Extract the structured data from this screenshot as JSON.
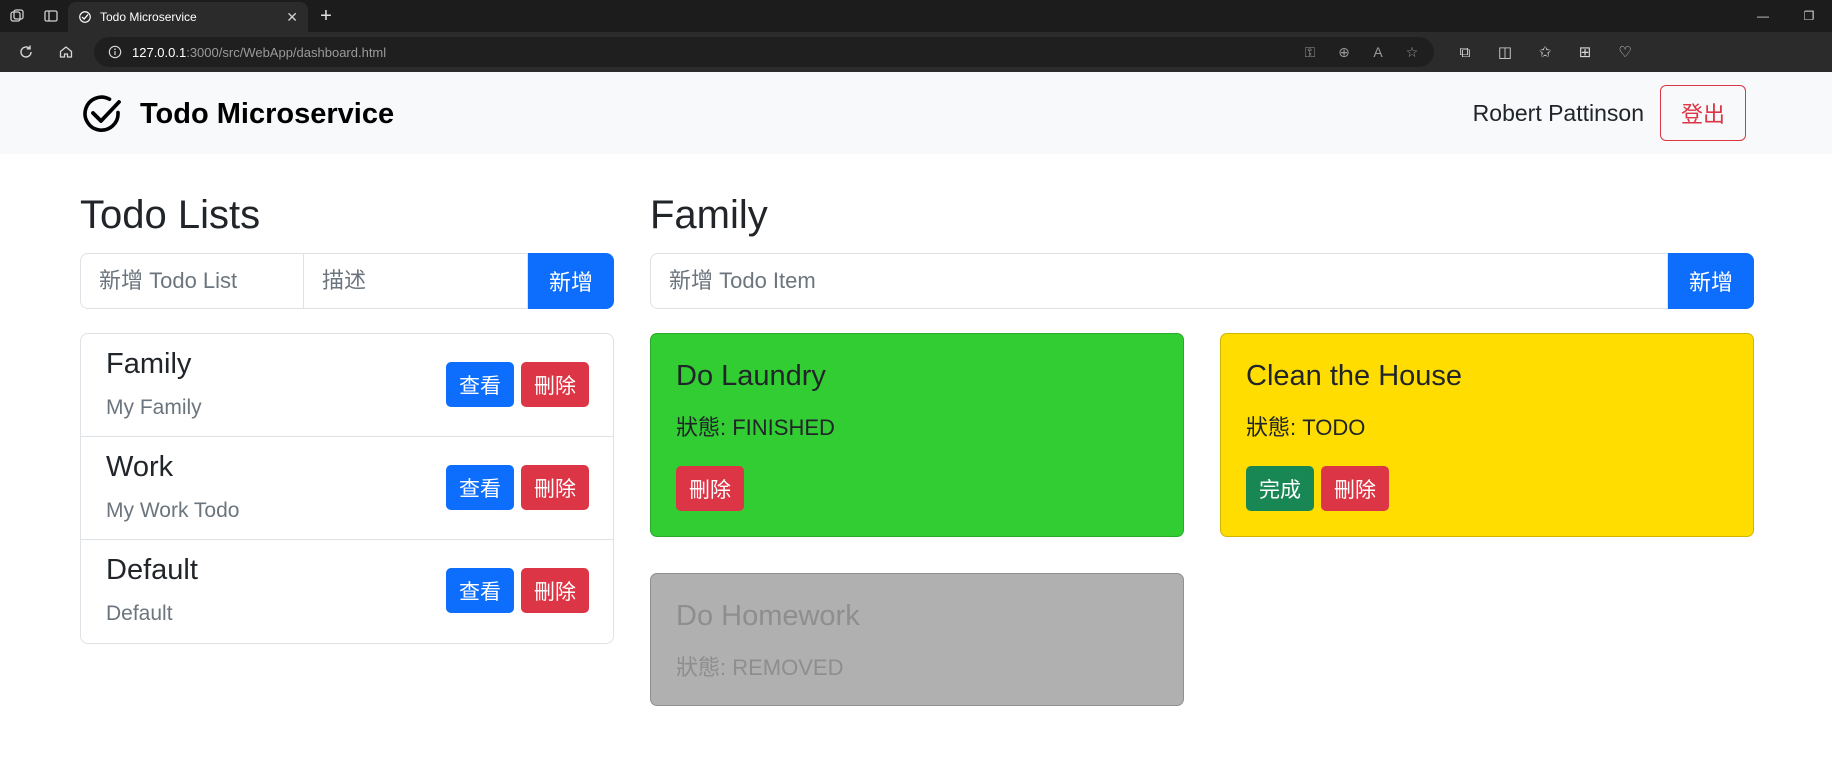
{
  "browser": {
    "tab_title": "Todo Microservice",
    "url_host": "127.0.0.1",
    "url_rest": ":3000/src/WebApp/dashboard.html"
  },
  "navbar": {
    "brand": "Todo Microservice",
    "user_name": "Robert Pattinson",
    "logout_label": "登出"
  },
  "lists_panel": {
    "title": "Todo Lists",
    "name_placeholder": "新增 Todo List",
    "desc_placeholder": "描述",
    "add_label": "新增",
    "view_label": "查看",
    "delete_label": "刪除",
    "items": [
      {
        "name": "Family",
        "description": "My Family"
      },
      {
        "name": "Work",
        "description": "My Work Todo"
      },
      {
        "name": "Default",
        "description": "Default"
      }
    ]
  },
  "items_panel": {
    "title": "Family",
    "item_placeholder": "新增 Todo Item",
    "add_label": "新增",
    "complete_label": "完成",
    "delete_label": "刪除",
    "items": [
      {
        "title": "Do Laundry",
        "status": "狀態: FINISHED",
        "color": "#32cd32"
      },
      {
        "title": "Clean the House",
        "status": "狀態: TODO",
        "color": "#ffdd00"
      },
      {
        "title": "Do Homework",
        "status": "狀態: REMOVED",
        "color": "#b0b0b0"
      }
    ]
  },
  "colors": {
    "primary": "#0d6efd",
    "danger": "#dc3545",
    "success": "#198754"
  }
}
